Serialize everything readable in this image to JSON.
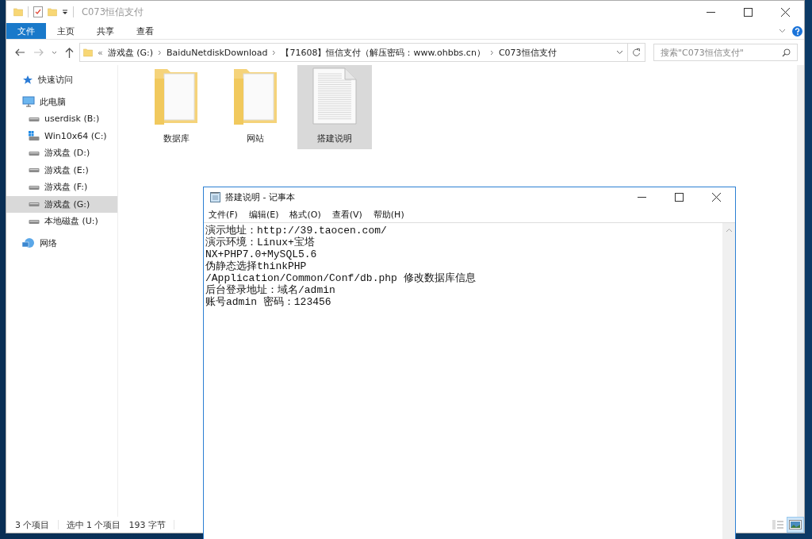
{
  "explorer": {
    "title": "C073恒信支付",
    "ribbon_tabs": [
      {
        "label": "文件",
        "selected": true
      },
      {
        "label": "主页",
        "selected": false
      },
      {
        "label": "共享",
        "selected": false
      },
      {
        "label": "查看",
        "selected": false
      }
    ],
    "breadcrumb": {
      "overflow": "«",
      "items": [
        "游戏盘 (G:)",
        "BaiduNetdiskDownload",
        "【71608】恒信支付（解压密码：www.ohbbs.cn）",
        "C073恒信支付"
      ]
    },
    "search": {
      "placeholder": "搜索\"C073恒信支付\""
    },
    "nav": [
      {
        "label": "快速访问",
        "kind": "star",
        "selected": false
      },
      {
        "label": "此电脑",
        "kind": "pc",
        "selected": false,
        "children": [
          {
            "label": "userdisk (B:)",
            "kind": "drive",
            "selected": false
          },
          {
            "label": "Win10x64 (C:)",
            "kind": "windrive",
            "selected": false
          },
          {
            "label": "游戏盘 (D:)",
            "kind": "drive",
            "selected": false
          },
          {
            "label": "游戏盘 (E:)",
            "kind": "drive",
            "selected": false
          },
          {
            "label": "游戏盘 (F:)",
            "kind": "drive",
            "selected": false
          },
          {
            "label": "游戏盘 (G:)",
            "kind": "drive",
            "selected": true
          },
          {
            "label": "本地磁盘 (U:)",
            "kind": "drive",
            "selected": false
          }
        ]
      },
      {
        "label": "网络",
        "kind": "network",
        "selected": false
      }
    ],
    "files": [
      {
        "name": "数据库",
        "kind": "folder",
        "selected": false
      },
      {
        "name": "网站",
        "kind": "folder",
        "selected": false
      },
      {
        "name": "搭建说明",
        "kind": "text",
        "selected": true
      }
    ],
    "status": [
      "3 个项目",
      "选中 1 个项目",
      "193 字节"
    ],
    "views": [
      {
        "kind": "details",
        "selected": false
      },
      {
        "kind": "large",
        "selected": true
      }
    ]
  },
  "notepad": {
    "title": "搭建说明 - 记事本",
    "menu": [
      "文件(F)",
      "编辑(E)",
      "格式(O)",
      "查看(V)",
      "帮助(H)"
    ],
    "lines": [
      "演示地址：http://39.taocen.com/",
      "演示环境：Linux+宝塔",
      "NX+PHP7.0+MySQL5.6",
      "伪静态选择thinkPHP",
      "/Application/Common/Conf/db.php 修改数据库信息",
      "后台登录地址：域名/admin",
      "账号admin 密码：123456"
    ]
  }
}
